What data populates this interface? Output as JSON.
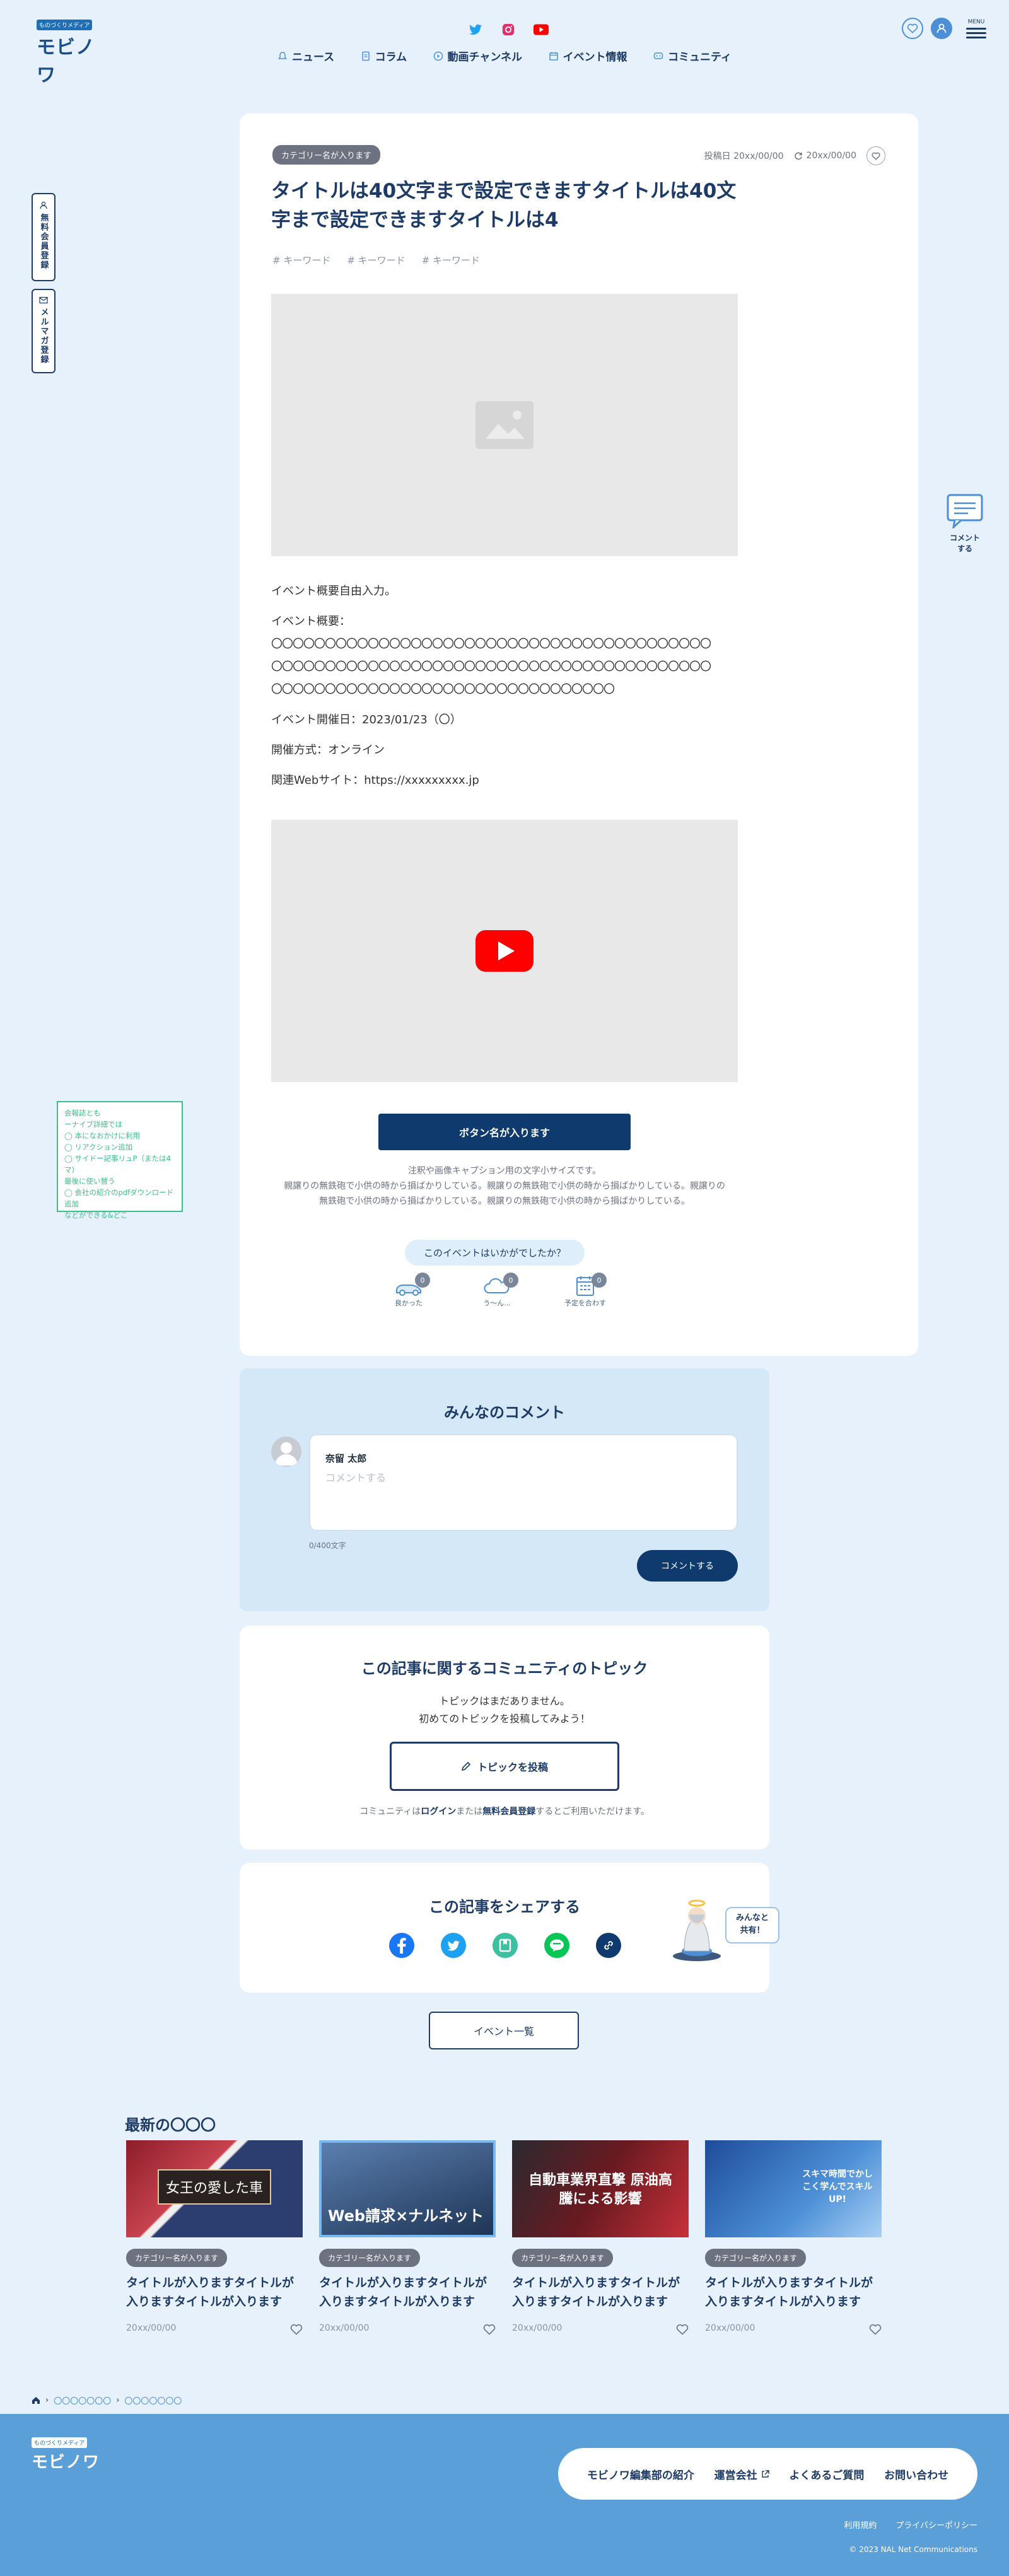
{
  "header": {
    "logo_small": "ものづくりメディア",
    "logo_main": "モビノワ",
    "nav": [
      "ニュース",
      "コラム",
      "動画チャンネル",
      "イベント情報",
      "コミュニティ"
    ],
    "menu_label": "MENU"
  },
  "side": {
    "tab1": "無料会員登録",
    "tab2": "メルマガ登録",
    "comment": "コメント\nする",
    "note_lines": [
      "会報誌とも",
      "ーナイブ詳細では",
      "◯ 本になおかけに利用",
      "◯ リアクション追加",
      "◯ サイドー記事リュP（または4マ)",
      "最後に使い替う",
      "◯ 会社の紹介のpdfダウンロード追加",
      "などができる&どこ"
    ]
  },
  "article": {
    "category": "カテゴリー名が入ります",
    "posted": "投稿日 20xx/00/00",
    "updated": "20xx/00/00",
    "title": "タイトルは40文字まで設定できますタイトルは40文字まで設定できますタイトルは4",
    "keywords": [
      "# キーワード",
      "# キーワード",
      "# キーワード"
    ],
    "body": [
      "イベント概要自由入力。",
      "イベント概要：",
      "〇〇〇〇〇〇〇〇〇〇〇〇〇〇〇〇〇〇〇〇〇〇〇〇〇〇〇〇〇〇〇〇〇〇〇〇〇〇〇〇〇",
      "〇〇〇〇〇〇〇〇〇〇〇〇〇〇〇〇〇〇〇〇〇〇〇〇〇〇〇〇〇〇〇〇〇〇〇〇〇〇〇〇〇",
      "〇〇〇〇〇〇〇〇〇〇〇〇〇〇〇〇〇〇〇〇〇〇〇〇〇〇〇〇〇〇〇〇",
      "イベント開催日：2023/01/23（〇）",
      "開催方式：オンライン",
      "関連Webサイト：https://xxxxxxxxx.jp"
    ],
    "button": "ボタン名が入ります",
    "notes": [
      "注釈や画像キャプション用の文字小サイズです。",
      "親譲りの無鉄砲で小供の時から損ばかりしている。親譲りの無鉄砲で小供の時から損ばかりしている。親譲りの",
      "無鉄砲で小供の時から損ばかりしている。親譲りの無鉄砲で小供の時から損ばかりしている。"
    ],
    "reaction_question": "このイベントはいかがでしたか？",
    "reactions": [
      {
        "label": "良かった",
        "count": "0"
      },
      {
        "label": "う〜ん...",
        "count": "0"
      },
      {
        "label": "予定を合わす",
        "count": "0"
      }
    ]
  },
  "comments": {
    "title": "みんなのコメント",
    "user": "奈留 太郎",
    "placeholder": "コメントする",
    "counter": "0/400文字",
    "submit": "コメントする"
  },
  "community": {
    "title": "この記事に関するコミュニティのトピック",
    "empty1": "トピックはまだありません。",
    "empty2": "初めてのトピックを投稿してみよう！",
    "post_button": "トピックを投稿",
    "foot_pre": "コミュニティは",
    "login": "ログイン",
    "foot_mid": "または",
    "register": "無料会員登録",
    "foot_post": "するとご利用いただけます。"
  },
  "share": {
    "title": "この記事をシェアする",
    "bubble": "みんなと\n共有！"
  },
  "event_list_button": "イベント一覧",
  "latest": {
    "title": "最新の〇〇〇",
    "articles": [
      {
        "img_text": "女王の愛した車",
        "category": "カテゴリー名が入ります",
        "title": "タイトルが入りますタイトルが入りますタイトルが入ります",
        "date": "20xx/00/00"
      },
      {
        "img_text": "Web請求×ナルネット",
        "category": "カテゴリー名が入ります",
        "title": "タイトルが入りますタイトルが入りますタイトルが入ります",
        "date": "20xx/00/00"
      },
      {
        "img_text": "自動車業界直撃 原油高騰による影響",
        "category": "カテゴリー名が入ります",
        "title": "タイトルが入りますタイトルが入りますタイトルが入ります",
        "date": "20xx/00/00"
      },
      {
        "img_text": "スキマ時間でかしこく学んでスキルUP!",
        "category": "カテゴリー名が入ります",
        "title": "タイトルが入りますタイトルが入りますタイトルが入ります",
        "date": "20xx/00/00"
      }
    ]
  },
  "breadcrumb": [
    "〇〇〇〇〇〇〇",
    "〇〇〇〇〇〇〇"
  ],
  "footer": {
    "logo_small": "ものづくりメディア",
    "logo_main": "モビノワ",
    "links": [
      "モビノワ編集部の紹介",
      "運営会社",
      "よくあるご質問",
      "お問い合わせ"
    ],
    "terms": "利用規約",
    "privacy": "プライバシーポリシー",
    "copyright": "© 2023 NAL Net Communications"
  },
  "colors": {
    "accent": "#1d3b66",
    "primary_btn": "#0e3a6e",
    "bg": "#e6f1fb",
    "footer": "#5b9fd9"
  }
}
